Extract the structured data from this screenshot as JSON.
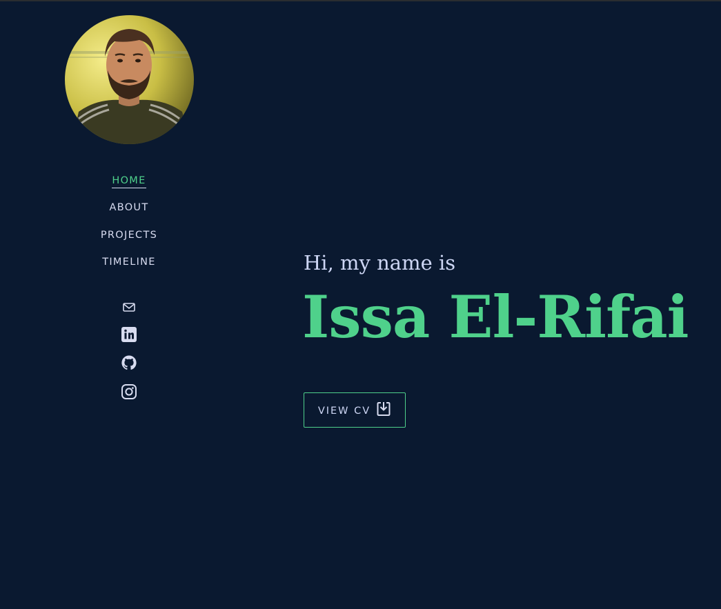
{
  "colors": {
    "background": "#0a1930",
    "accent": "#4fd18b",
    "text": "#d8dcf0"
  },
  "profile": {
    "avatar_icon": "profile-photo"
  },
  "nav": {
    "items": [
      {
        "label": "HOME",
        "active": true
      },
      {
        "label": "ABOUT",
        "active": false
      },
      {
        "label": "PROJECTS",
        "active": false
      },
      {
        "label": "TIMELINE",
        "active": false
      }
    ]
  },
  "socials": [
    {
      "icon": "mail-icon"
    },
    {
      "icon": "linkedin-icon"
    },
    {
      "icon": "github-icon"
    },
    {
      "icon": "instagram-icon"
    }
  ],
  "hero": {
    "intro": "Hi, my name is",
    "name": "Issa El-Rifai",
    "cv_button_label": "VIEW CV",
    "cv_button_icon": "download-file-icon"
  }
}
